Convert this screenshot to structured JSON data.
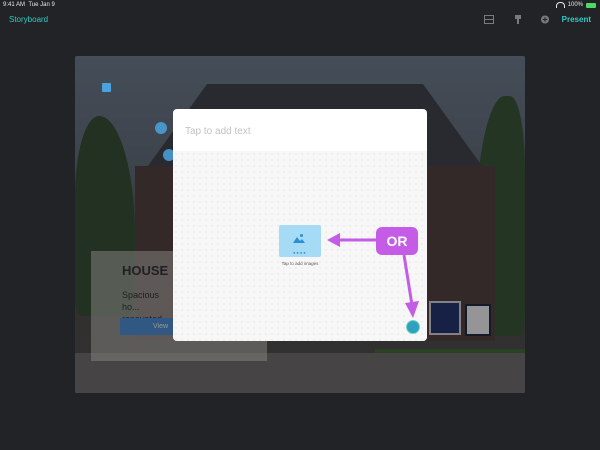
{
  "status_bar": {
    "time": "9:41 AM",
    "date": "Tue Jan 9",
    "battery": "100%"
  },
  "nav": {
    "title": "Storyboard",
    "present_label": "Present"
  },
  "canvas": {
    "card_title": "HOUSE",
    "card_text": "Spacious ho... renovated.",
    "card_button": "View"
  },
  "modal": {
    "text_placeholder": "Tap to add text",
    "image_caption": "Tap to add images"
  },
  "annotation": {
    "or_label": "OR"
  },
  "colors": {
    "accent": "#33c9c1",
    "annotation": "#c45ce6",
    "image_tile": "#a6dbf6"
  }
}
